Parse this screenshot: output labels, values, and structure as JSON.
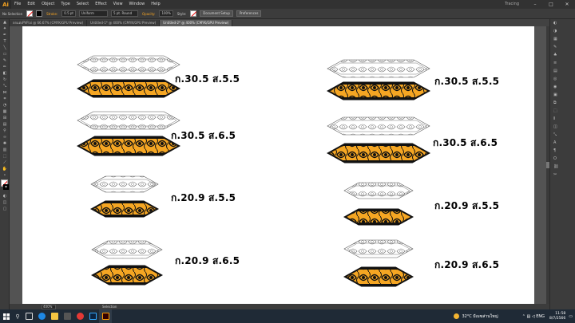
{
  "menubar": {
    "logo": "Ai",
    "items": [
      "File",
      "Edit",
      "Object",
      "Type",
      "Select",
      "Effect",
      "View",
      "Window",
      "Help"
    ],
    "workspace": "Tracing"
  },
  "controlbar": {
    "selection": "No Selection",
    "stroke_label": "Stroke:",
    "stroke_weight": "0.5 pt",
    "profile": "Uniform",
    "brush": "5 pt. Round",
    "opacity_label": "Opacity:",
    "opacity": "100%",
    "style_label": "Style:",
    "document_setup": "Document Setup",
    "preferences": "Preferences"
  },
  "tabs": [
    {
      "label": "ตกแต่งPVP.ai @ 66.67% (CMYK/GPU Preview)",
      "active": false
    },
    {
      "label": "Untitled-1* @ 400% (CMYK/GPU Preview)",
      "active": false
    },
    {
      "label": "Untitled-2* @ 400% (CMYK/GPU Preview)",
      "active": true
    }
  ],
  "artboard": {
    "left_labels": [
      "ก.30.5 ส.5.5",
      "ก.30.5 ส.6.5",
      "ก.20.9 ส.5.5",
      "ก.20.9 ส.6.5"
    ],
    "right_labels": [
      "ก.30.5 ส.5.5",
      "ก.30.5 ส.6.5",
      "ก.20.9 ส.5.5",
      "ก.20.9 ส.6.5"
    ],
    "ornament_fill": "#f5a623",
    "ornament_dark": "#111111"
  },
  "statusbar": {
    "zoom": "400%",
    "mode": "Selection"
  },
  "taskbar": {
    "temperature": "32°C",
    "weather_text": "มีเมฆส่วนใหญ่",
    "language": "ENG",
    "time": "11:58",
    "date": "8/7/2566"
  }
}
